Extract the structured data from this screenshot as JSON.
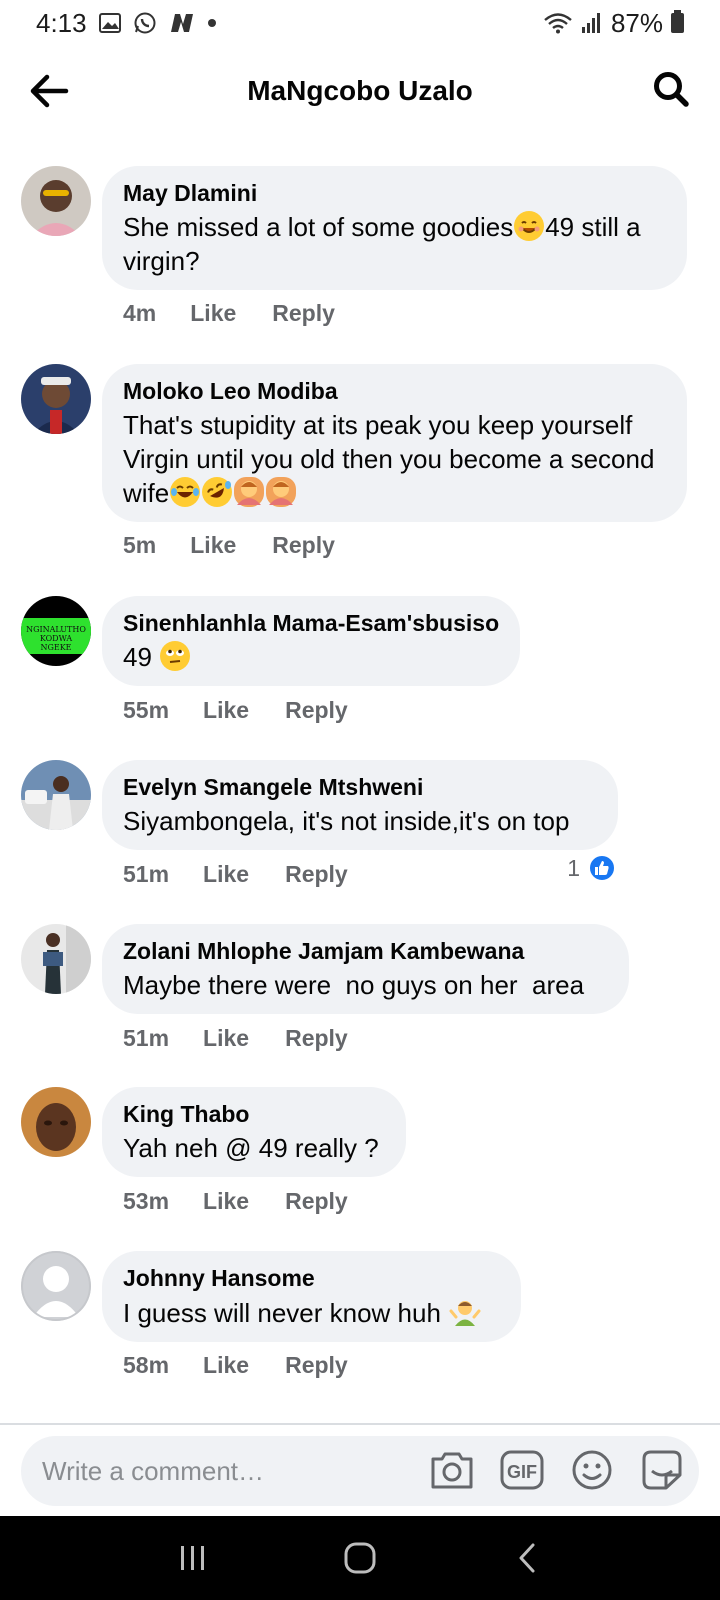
{
  "status_bar": {
    "time": "4:13",
    "battery": "87%"
  },
  "header": {
    "title": "MaNgcobo Uzalo"
  },
  "comments": [
    {
      "name": "May Dlamini",
      "text_parts": [
        "She missed a lot of some goodies",
        "49 still a virgin?"
      ],
      "time": "4m",
      "like": "Like",
      "reply": "Reply"
    },
    {
      "name": "Moloko Leo Modiba",
      "text": "That's stupidity at its peak you keep yourself Virgin until you old then you become a second wife",
      "time": "5m",
      "like": "Like",
      "reply": "Reply"
    },
    {
      "name": "Sinenhlanhla Mama-Esam'sbusiso",
      "text": "49",
      "time": "55m",
      "like": "Like",
      "reply": "Reply",
      "avatar_text": [
        "NGINALUTHO",
        "KODWA",
        "NGEKE"
      ]
    },
    {
      "name": "Evelyn Smangele Mtshweni",
      "text": "Siyambongela, it's not inside,it's on top",
      "time": "51m",
      "like": "Like",
      "reply": "Reply",
      "reaction_count": "1"
    },
    {
      "name": "Zolani Mhlophe Jamjam Kambewana",
      "text": "Maybe there were  no guys on her  area",
      "time": "51m",
      "like": "Like",
      "reply": "Reply"
    },
    {
      "name": "King Thabo",
      "text": "Yah neh @ 49 really ?",
      "time": "53m",
      "like": "Like",
      "reply": "Reply"
    },
    {
      "name": "Johnny Hansome",
      "text": "I guess will never know huh",
      "time": "58m",
      "like": "Like",
      "reply": "Reply"
    }
  ],
  "composer": {
    "placeholder": "Write a comment…",
    "gif_label": "GIF"
  },
  "colors": {
    "bubble": "#f0f2f5",
    "meta_text": "#65676b",
    "like_blue": "#1877f2"
  }
}
